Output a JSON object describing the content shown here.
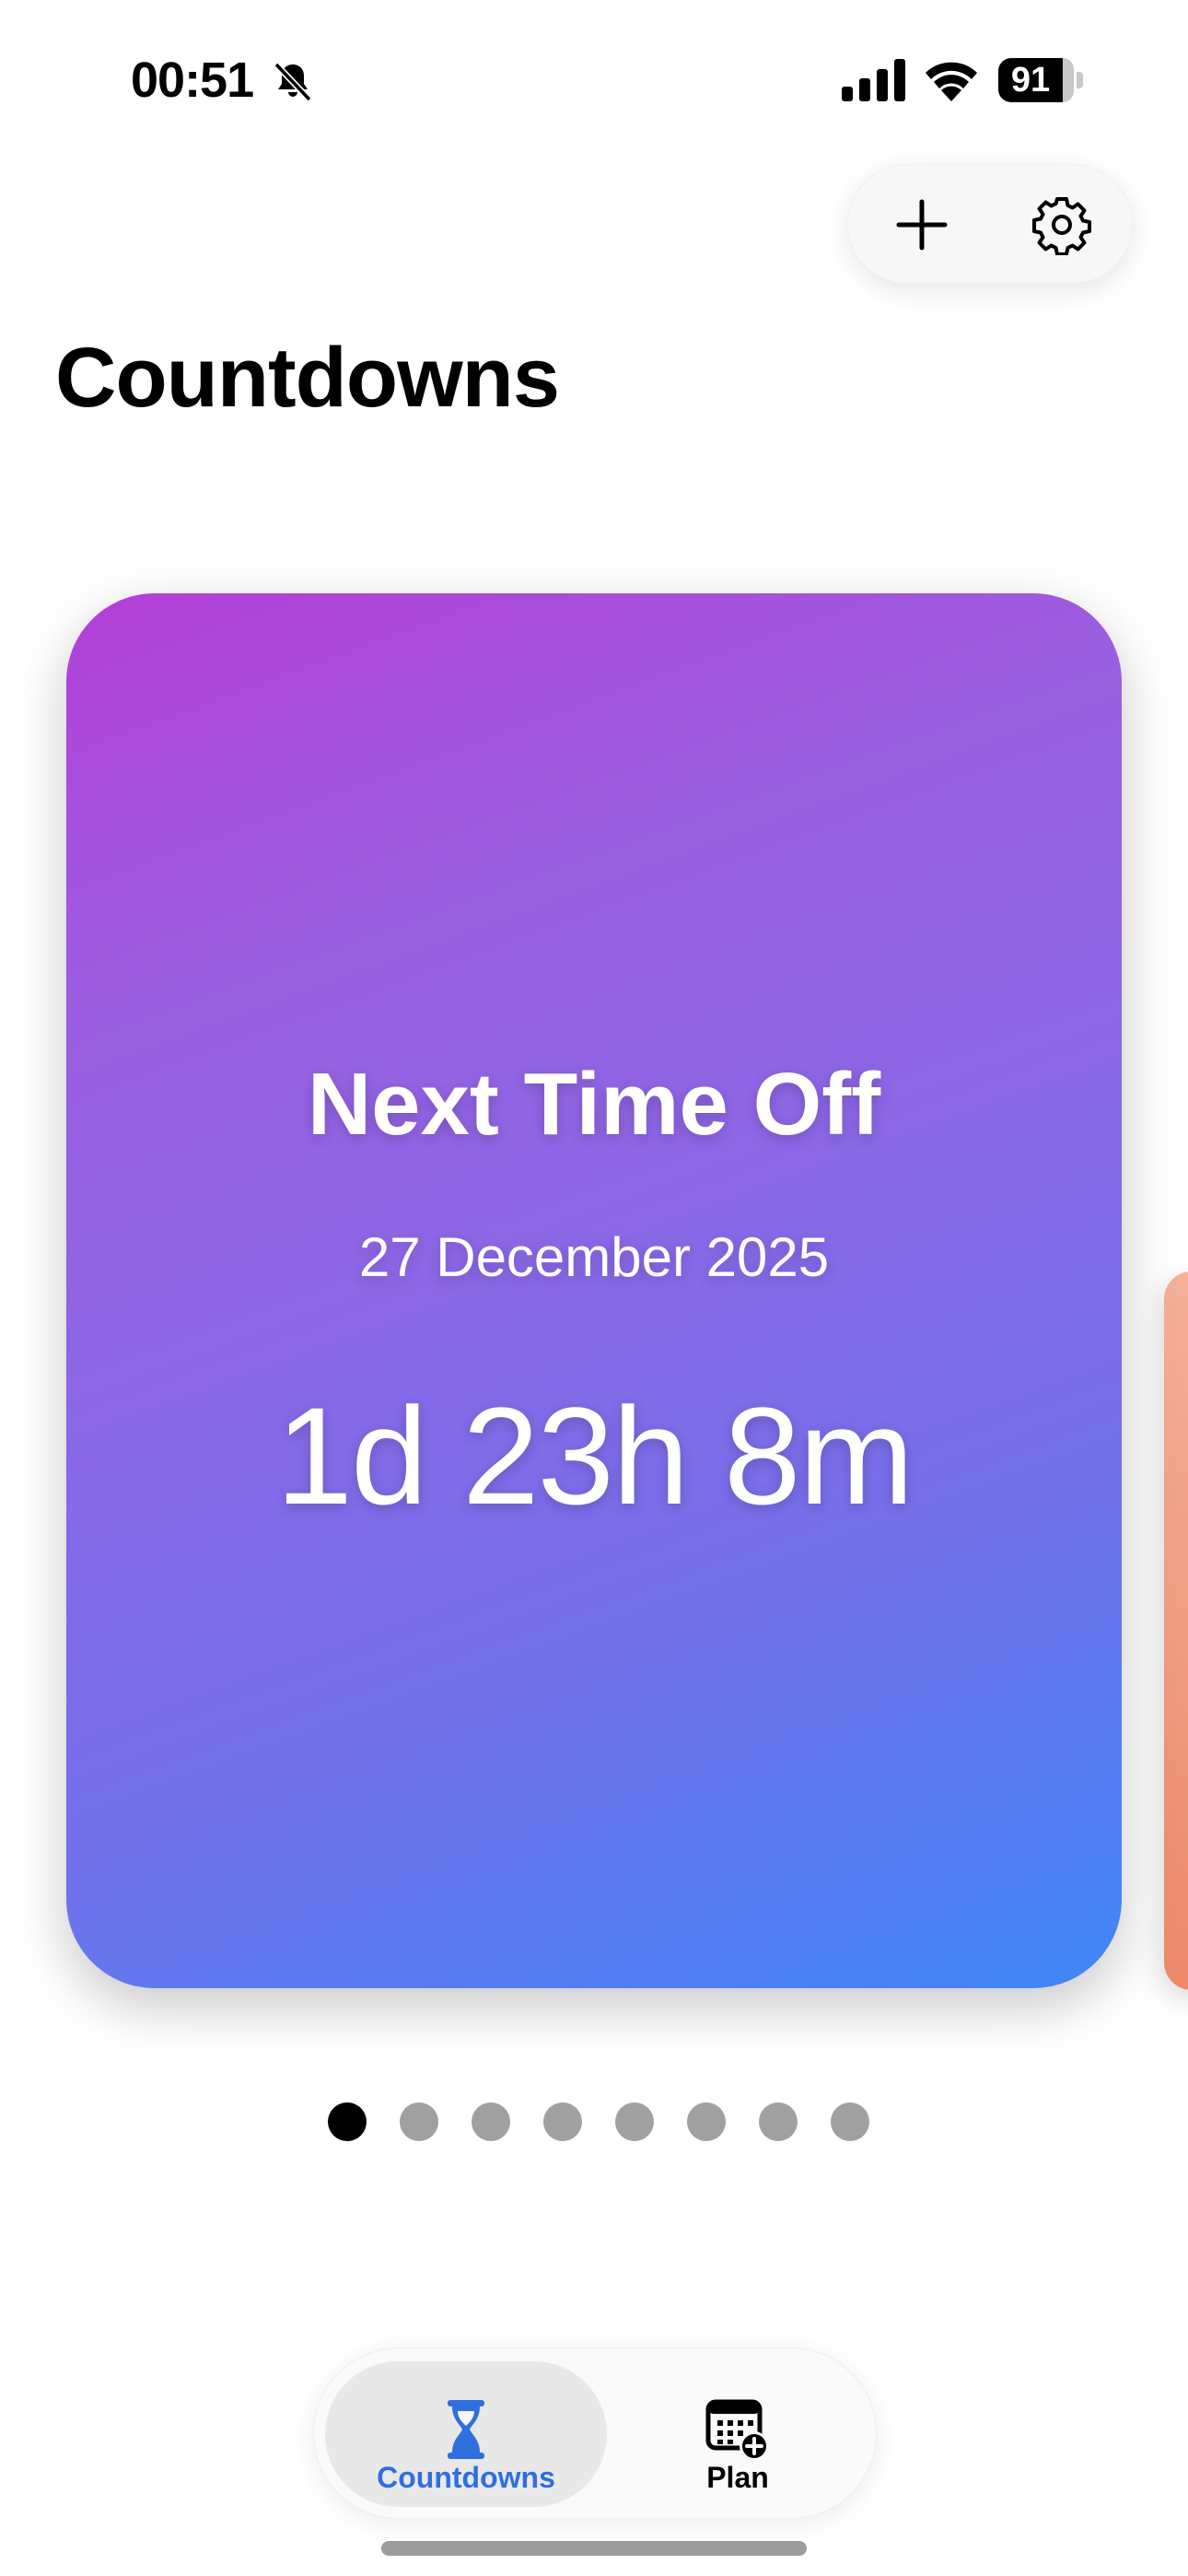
{
  "status_bar": {
    "time": "00:51",
    "battery_level": "91"
  },
  "toolbar": {
    "add_icon": "plus-icon",
    "settings_icon": "gear-icon"
  },
  "page": {
    "title": "Countdowns"
  },
  "countdown_card": {
    "name": "Next Time Off",
    "date": "27 December 2025",
    "remaining": "1d 23h 8m",
    "gradient_start": "#b43fd6",
    "gradient_end": "#3f87f6"
  },
  "pager": {
    "total_pages": 8,
    "current_page": 1
  },
  "tab_bar": {
    "tabs": [
      {
        "label": "Countdowns",
        "icon": "hourglass-icon",
        "selected": true,
        "color": "#2f6fe0"
      },
      {
        "label": "Plan",
        "icon": "calendar-add-icon",
        "selected": false
      }
    ]
  }
}
